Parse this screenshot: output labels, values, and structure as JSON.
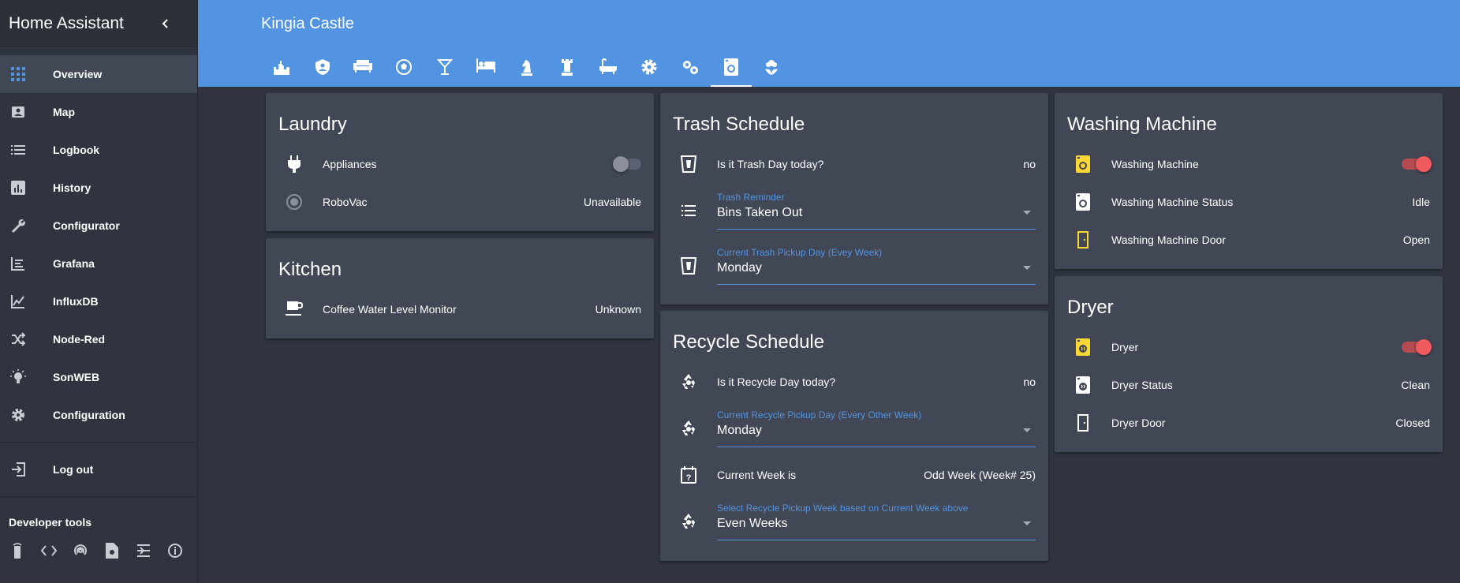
{
  "app": {
    "title": "Home Assistant"
  },
  "sidebar": {
    "items": [
      {
        "label": "Overview",
        "icon": "grid-icon"
      },
      {
        "label": "Map",
        "icon": "map-icon"
      },
      {
        "label": "Logbook",
        "icon": "logbook-icon"
      },
      {
        "label": "History",
        "icon": "history-icon"
      },
      {
        "label": "Configurator",
        "icon": "wrench-icon"
      },
      {
        "label": "Grafana",
        "icon": "grafana-icon"
      },
      {
        "label": "InfluxDB",
        "icon": "chart-icon"
      },
      {
        "label": "Node-Red",
        "icon": "shuffle-icon"
      },
      {
        "label": "SonWEB",
        "icon": "lightbulb-icon"
      },
      {
        "label": "Configuration",
        "icon": "gear-icon"
      }
    ],
    "logout": "Log out",
    "dev_tools_title": "Developer tools"
  },
  "header": {
    "title": "Kingia Castle"
  },
  "laundry": {
    "title": "Laundry",
    "appliances": "Appliances",
    "robovac": "RoboVac",
    "robovac_state": "Unavailable"
  },
  "kitchen": {
    "title": "Kitchen",
    "coffee": "Coffee Water Level Monitor",
    "coffee_state": "Unknown"
  },
  "trash": {
    "title": "Trash Schedule",
    "is_trash_day": "Is it Trash Day today?",
    "is_trash_day_value": "no",
    "reminder_label": "Trash Reminder",
    "reminder_value": "Bins Taken Out",
    "pickup_label": "Current Trash Pickup Day (Evey Week)",
    "pickup_value": "Monday"
  },
  "recycle": {
    "title": "Recycle Schedule",
    "is_recycle_day": "Is it Recycle Day today?",
    "is_recycle_day_value": "no",
    "pickup_label": "Current Recycle Pickup Day (Every Other Week)",
    "pickup_value": "Monday",
    "week_label": "Current Week is",
    "week_value": "Odd Week (Week# 25)",
    "select_label": "Select Recycle Pickup Week based on Current Week above",
    "select_value": "Even Weeks"
  },
  "washer": {
    "title": "Washing Machine",
    "switch": "Washing Machine",
    "status": "Washing Machine Status",
    "status_value": "Idle",
    "door": "Washing Machine Door",
    "door_value": "Open"
  },
  "dryer": {
    "title": "Dryer",
    "switch": "Dryer",
    "status": "Dryer Status",
    "status_value": "Clean",
    "door": "Dryer Door",
    "door_value": "Closed"
  },
  "colors": {
    "accent": "#5294e2",
    "card": "#414754",
    "background": "#2f343f",
    "toggle_on": "#ef5a5f",
    "icon_active": "#fdd835"
  }
}
